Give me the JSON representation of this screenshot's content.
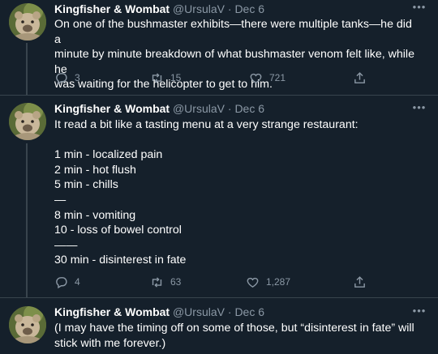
{
  "tweets": [
    {
      "name": "Kingfisher & Wombat",
      "handle": "@UrsulaV",
      "sep": "·",
      "date": "Dec 6",
      "text": "On one of the bushmaster exhibits—there were multiple tanks—he did a\nminute by minute breakdown of what bushmaster venom felt like, while he\nwas waiting for the helicopter to get to him.",
      "replies": "3",
      "retweets": "15",
      "likes": "721"
    },
    {
      "name": "Kingfisher & Wombat",
      "handle": "@UrsulaV",
      "sep": "·",
      "date": "Dec 6",
      "text": "It read a bit like a tasting menu at a very strange restaurant:\n\n1 min - localized pain\n2 min - hot flush\n5 min - chills\n—\n8 min - vomiting\n10 - loss of bowel control\n——\n30 min - disinterest in fate",
      "replies": "4",
      "retweets": "63",
      "likes": "1,287"
    },
    {
      "name": "Kingfisher & Wombat",
      "handle": "@UrsulaV",
      "sep": "·",
      "date": "Dec 6",
      "text": "(I may have the timing off on some of those, but “disinterest in fate” will\nstick with me forever.)"
    }
  ],
  "icons": {
    "more": "more-dots-icon",
    "reply": "reply-icon",
    "retweet": "retweet-icon",
    "like": "heart-icon",
    "share": "share-icon"
  },
  "colors": {
    "background": "#15202b",
    "text": "#ffffff",
    "secondary": "#8b98a5",
    "border": "#38444d"
  }
}
